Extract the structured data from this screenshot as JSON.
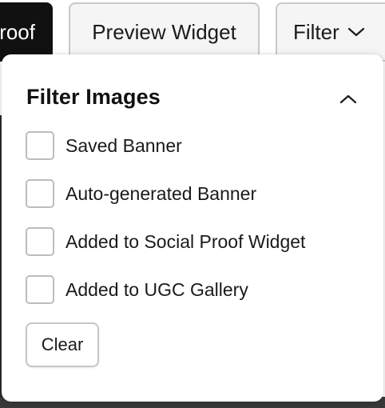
{
  "toolbar": {
    "partial_button_label": "roof",
    "preview_widget_label": "Preview Widget",
    "filter_label": "Filter"
  },
  "filter_panel": {
    "title": "Filter Images",
    "options": [
      {
        "label": "Saved Banner",
        "checked": false
      },
      {
        "label": "Auto-generated Banner",
        "checked": false
      },
      {
        "label": "Added to Social Proof Widget",
        "checked": false
      },
      {
        "label": "Added to UGC Gallery",
        "checked": false
      }
    ],
    "clear_label": "Clear"
  },
  "colors": {
    "dark_button_bg": "#111111",
    "checkbox_border": "#bdbdbd",
    "outline_button_border": "#c9c9c9"
  },
  "icons": {
    "filter_toggle": "chevron-down-icon",
    "panel_collapse": "chevron-up-icon"
  }
}
